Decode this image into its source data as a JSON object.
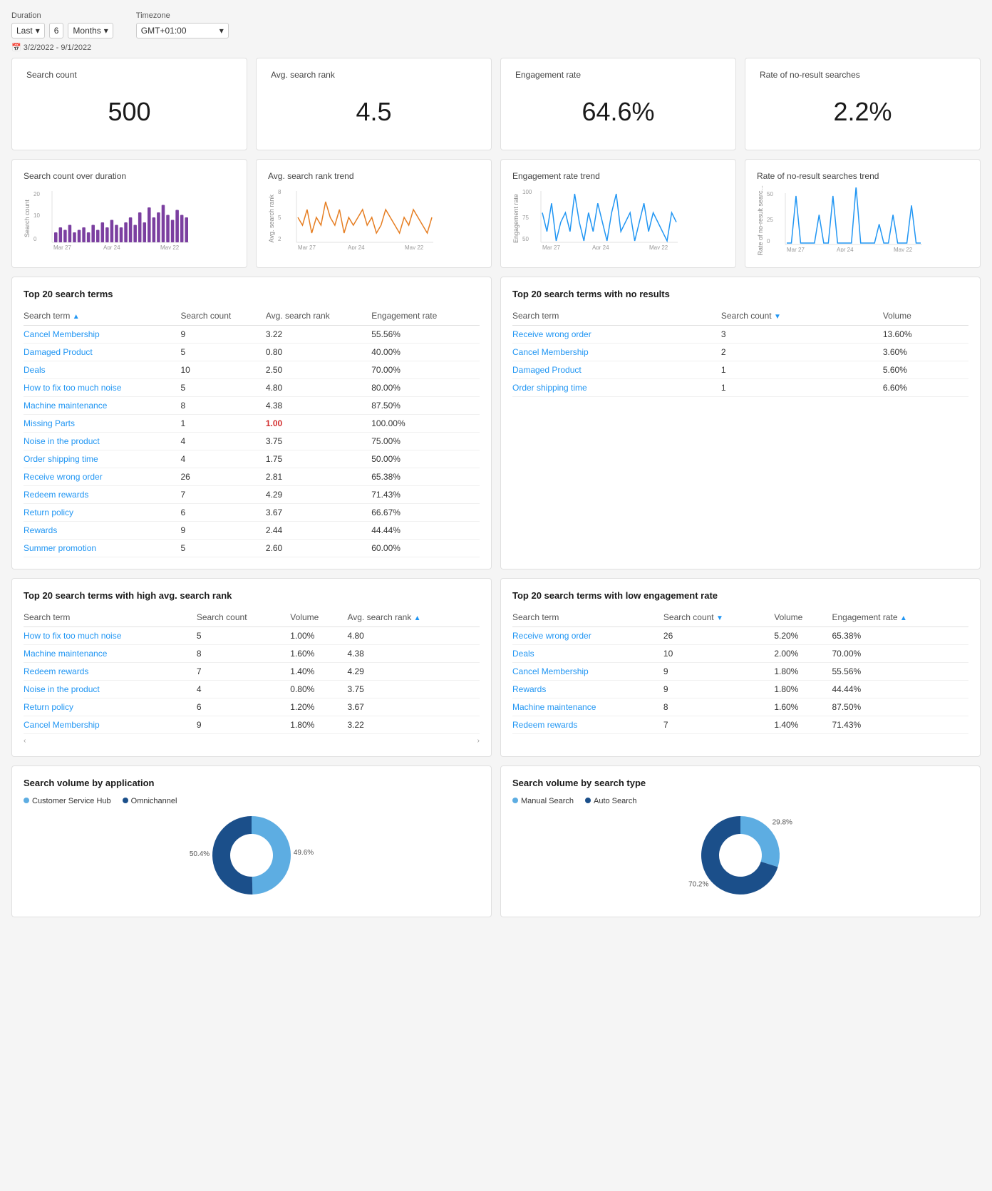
{
  "controls": {
    "duration_label": "Duration",
    "timezone_label": "Timezone",
    "duration_prefix": "Last",
    "duration_value": "6",
    "duration_unit": "Months",
    "timezone_value": "GMT+01:00",
    "date_range": "3/2/2022 - 9/1/2022"
  },
  "metrics": [
    {
      "id": "search_count",
      "title": "Search count",
      "value": "500"
    },
    {
      "id": "avg_search_rank",
      "title": "Avg. search rank",
      "value": "4.5"
    },
    {
      "id": "engagement_rate",
      "title": "Engagement rate",
      "value": "64.6%"
    },
    {
      "id": "no_result_rate",
      "title": "Rate of no-result searches",
      "value": "2.2%"
    }
  ],
  "trend_charts": [
    {
      "id": "search_count_trend",
      "title": "Search count over duration",
      "y_label": "Search count",
      "color": "#7B3FA0",
      "type": "bar"
    },
    {
      "id": "avg_rank_trend",
      "title": "Avg. search rank trend",
      "y_label": "Avg. search rank",
      "color": "#E67E22",
      "type": "line"
    },
    {
      "id": "engagement_trend",
      "title": "Engagement rate trend",
      "y_label": "Engagement rate",
      "color": "#2196F3",
      "type": "line"
    },
    {
      "id": "no_result_trend",
      "title": "Rate of no-result searches trend",
      "y_label": "Rate of no-result searc...",
      "color": "#2196F3",
      "type": "line"
    }
  ],
  "chart_x_labels": [
    "Mar 27",
    "Apr 24",
    "May 22"
  ],
  "top20_search_terms": {
    "title": "Top 20 search terms",
    "columns": [
      "Search term",
      "Search count",
      "Avg. search rank",
      "Engagement rate"
    ],
    "sort_col": 0,
    "rows": [
      {
        "term": "Cancel Membership",
        "count": "9",
        "rank": "3.22",
        "engagement": "55.56%"
      },
      {
        "term": "Damaged Product",
        "count": "5",
        "rank": "0.80",
        "engagement": "40.00%"
      },
      {
        "term": "Deals",
        "count": "10",
        "rank": "2.50",
        "engagement": "70.00%"
      },
      {
        "term": "How to fix too much noise",
        "count": "5",
        "rank": "4.80",
        "engagement": "80.00%"
      },
      {
        "term": "Machine maintenance",
        "count": "8",
        "rank": "4.38",
        "engagement": "87.50%"
      },
      {
        "term": "Missing Parts",
        "count": "1",
        "rank": "1.00",
        "engagement": "100.00%",
        "rank_highlight": true
      },
      {
        "term": "Noise in the product",
        "count": "4",
        "rank": "3.75",
        "engagement": "75.00%"
      },
      {
        "term": "Order shipping time",
        "count": "4",
        "rank": "1.75",
        "engagement": "50.00%"
      },
      {
        "term": "Receive wrong order",
        "count": "26",
        "rank": "2.81",
        "engagement": "65.38%"
      },
      {
        "term": "Redeem rewards",
        "count": "7",
        "rank": "4.29",
        "engagement": "71.43%"
      },
      {
        "term": "Return policy",
        "count": "6",
        "rank": "3.67",
        "engagement": "66.67%"
      },
      {
        "term": "Rewards",
        "count": "9",
        "rank": "2.44",
        "engagement": "44.44%"
      },
      {
        "term": "Summer promotion",
        "count": "5",
        "rank": "2.60",
        "engagement": "60.00%"
      }
    ]
  },
  "top20_no_results": {
    "title": "Top 20 search terms with no results",
    "columns": [
      "Search term",
      "Search count",
      "Volume"
    ],
    "sort_col": 1,
    "rows": [
      {
        "term": "Receive wrong order",
        "count": "3",
        "volume": "13.60%"
      },
      {
        "term": "Cancel Membership",
        "count": "2",
        "volume": "3.60%"
      },
      {
        "term": "Damaged Product",
        "count": "1",
        "volume": "5.60%"
      },
      {
        "term": "Order shipping time",
        "count": "1",
        "volume": "6.60%"
      }
    ]
  },
  "top20_high_rank": {
    "title": "Top 20 search terms with high avg. search rank",
    "columns": [
      "Search term",
      "Search count",
      "Volume",
      "Avg. search rank"
    ],
    "sort_col": 3,
    "rows": [
      {
        "term": "How to fix too much noise",
        "count": "5",
        "volume": "1.00%",
        "rank": "4.80"
      },
      {
        "term": "Machine maintenance",
        "count": "8",
        "volume": "1.60%",
        "rank": "4.38"
      },
      {
        "term": "Redeem rewards",
        "count": "7",
        "volume": "1.40%",
        "rank": "4.29"
      },
      {
        "term": "Noise in the product",
        "count": "4",
        "volume": "0.80%",
        "rank": "3.75"
      },
      {
        "term": "Return policy",
        "count": "6",
        "volume": "1.20%",
        "rank": "3.67"
      },
      {
        "term": "Cancel Membership",
        "count": "9",
        "volume": "1.80%",
        "rank": "3.22"
      }
    ]
  },
  "top20_low_engagement": {
    "title": "Top 20 search terms with low engagement rate",
    "columns": [
      "Search term",
      "Search count",
      "Volume",
      "Engagement rate"
    ],
    "sort_col": 3,
    "rows": [
      {
        "term": "Receive wrong order",
        "count": "26",
        "volume": "5.20%",
        "engagement": "65.38%"
      },
      {
        "term": "Deals",
        "count": "10",
        "volume": "2.00%",
        "engagement": "70.00%"
      },
      {
        "term": "Cancel Membership",
        "count": "9",
        "volume": "1.80%",
        "engagement": "55.56%"
      },
      {
        "term": "Rewards",
        "count": "9",
        "volume": "1.80%",
        "engagement": "44.44%"
      },
      {
        "term": "Machine maintenance",
        "count": "8",
        "volume": "1.60%",
        "engagement": "87.50%"
      },
      {
        "term": "Redeem rewards",
        "count": "7",
        "volume": "1.40%",
        "engagement": "71.43%"
      }
    ]
  },
  "pie_charts": [
    {
      "id": "by_application",
      "title": "Search volume by application",
      "legend": [
        {
          "label": "Customer Service Hub",
          "color": "#5DADE2"
        },
        {
          "label": "Omnichannel",
          "color": "#1B4F8A"
        }
      ],
      "slices": [
        {
          "label": "49.6%",
          "value": 49.6,
          "color": "#5DADE2"
        },
        {
          "label": "50.4%",
          "value": 50.4,
          "color": "#1B4F8A"
        }
      ]
    },
    {
      "id": "by_search_type",
      "title": "Search volume by search type",
      "legend": [
        {
          "label": "Manual Search",
          "color": "#5DADE2"
        },
        {
          "label": "Auto Search",
          "color": "#1B4F8A"
        }
      ],
      "slices": [
        {
          "label": "29.8%",
          "value": 29.8,
          "color": "#5DADE2"
        },
        {
          "label": "70.2%",
          "value": 70.2,
          "color": "#1B4F8A"
        }
      ]
    }
  ]
}
